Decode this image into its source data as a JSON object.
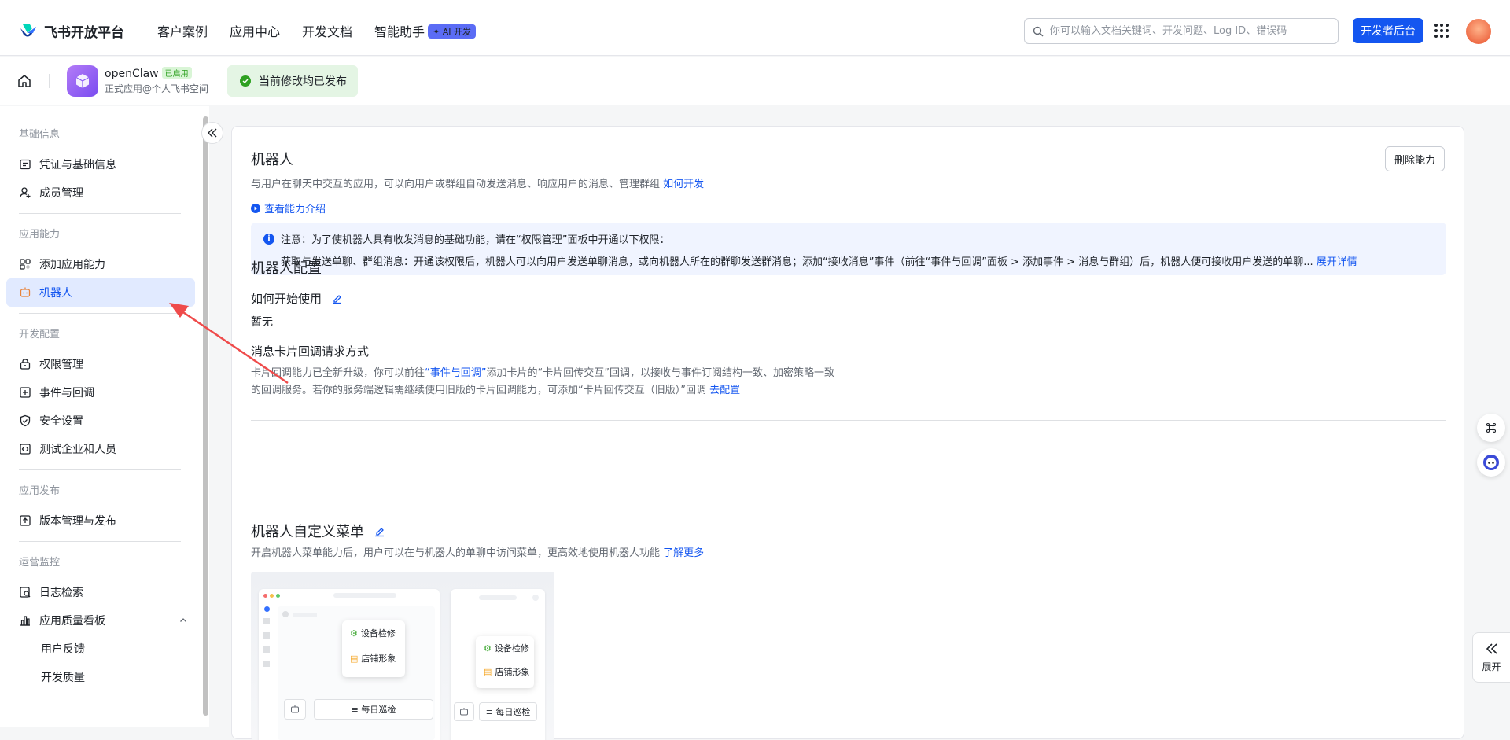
{
  "header": {
    "logo_text": "飞书开放平台",
    "nav": [
      "客户案例",
      "应用中心",
      "开发文档",
      "智能助手"
    ],
    "ai_badge": "✦ AI 开发",
    "search_placeholder": "你可以输入文档关键词、开发问题、Log ID、错误码",
    "dev_console": "开发者后台"
  },
  "app": {
    "name": "openClaw",
    "status_badge": "已启用",
    "subtitle": "正式应用@个人飞书空间",
    "publish_status": "当前修改均已发布"
  },
  "sidebar": {
    "sections": [
      {
        "title": "基础信息",
        "items": [
          {
            "label": "凭证与基础信息",
            "icon": "credential-icon"
          },
          {
            "label": "成员管理",
            "icon": "member-icon"
          }
        ]
      },
      {
        "title": "应用能力",
        "items": [
          {
            "label": "添加应用能力",
            "icon": "add-capability-icon"
          },
          {
            "label": "机器人",
            "icon": "robot-icon",
            "active": true
          }
        ]
      },
      {
        "title": "开发配置",
        "items": [
          {
            "label": "权限管理",
            "icon": "permission-icon"
          },
          {
            "label": "事件与回调",
            "icon": "event-icon"
          },
          {
            "label": "安全设置",
            "icon": "shield-icon"
          },
          {
            "label": "测试企业和人员",
            "icon": "test-icon"
          }
        ]
      },
      {
        "title": "应用发布",
        "items": [
          {
            "label": "版本管理与发布",
            "icon": "upload-icon"
          }
        ]
      },
      {
        "title": "运营监控",
        "items": [
          {
            "label": "日志检索",
            "icon": "log-icon"
          },
          {
            "label": "应用质量看板",
            "icon": "chart-icon"
          },
          {
            "label": "用户反馈"
          },
          {
            "label": "开发质量"
          }
        ]
      }
    ]
  },
  "robot": {
    "title": "机器人",
    "description": "与用户在聊天中交互的应用，可以向用户或群组自动发送消息、响应用户的消息、管理群组",
    "how_to_link": "如何开发",
    "intro_link": "查看能力介绍",
    "delete_button": "删除能力",
    "notice_title": "注意：为了使机器人具有收发消息的基础功能，请在“权限管理”面板中开通以下权限：",
    "notice_body": "获取与发送单聊、群组消息：开通该权限后，机器人可以向用户发送单聊消息，或向机器人所在的群聊发送群消息；添加“接收消息”事件（前往“事件与回调”面板 > 添加事件 > 消息与群组）后，机器人便可接收用户发送的单聊...",
    "notice_link": "展开详情"
  },
  "config": {
    "title": "机器人配置",
    "how_to_use_label": "如何开始使用",
    "how_to_use_value": "暂无",
    "card_callback_title": "消息卡片回调请求方式",
    "card_callback_text1_a": "卡片回调能力已全新升级，你可以前往",
    "card_callback_link1": "“事件与回调”",
    "card_callback_text1_b": "添加卡片的“卡片回传交互”回调，以接收与事件订阅结构一致、加密策略一致",
    "card_callback_text2": "的回调服务。若你的服务端逻辑需继续使用旧版的卡片回调能力，可添加“卡片回传交互（旧版）”回调",
    "card_callback_link2": "去配置"
  },
  "menu": {
    "title": "机器人自定义菜单",
    "description": "开启机器人菜单能力后，用户可以在与机器人的单聊中访问菜单，更高效地使用机器人功能",
    "learn_more": "了解更多",
    "preview_items": [
      "设备检修",
      "店铺形象"
    ],
    "preview_button": "≡ 每日巡检"
  },
  "right_panel": {
    "expand_label": "展开"
  }
}
